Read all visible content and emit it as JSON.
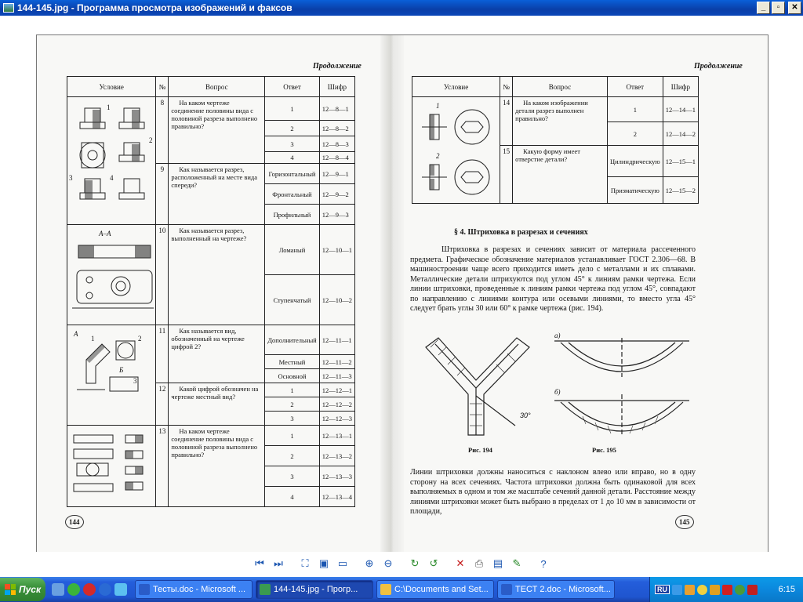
{
  "window": {
    "title": "144-145.jpg - Программа просмотра изображений и факсов",
    "btn_min": "_",
    "btn_max": "▫",
    "btn_close": "✕"
  },
  "left_page": {
    "continuation": "Продолжение",
    "headers": [
      "Условие",
      "№",
      "Вопрос",
      "Ответ",
      "Шифр"
    ],
    "rows": [
      {
        "num": "8",
        "question": "На каком чертеже соединение половины вида с половиной разреза выполнено правильно?",
        "answers": [
          [
            "1",
            "12—8—1"
          ],
          [
            "2",
            "12—8—2"
          ],
          [
            "3",
            "12—8—3"
          ],
          [
            "4",
            "12—8—4"
          ]
        ]
      },
      {
        "num": "9",
        "question": "Как называется разрез, расположенный на месте вида спереди?",
        "answers": [
          [
            "Горизонтальный",
            "12—9—1"
          ],
          [
            "Фронтальный",
            "12—9—2"
          ],
          [
            "Профильный",
            "12—9—3"
          ]
        ]
      },
      {
        "num": "10",
        "question": "Как называется разрез, выполненный на чертеже?",
        "answers": [
          [
            "Ломаный",
            "12—10—1"
          ],
          [
            "Ступенчатый",
            "12—10—2"
          ]
        ]
      },
      {
        "num": "11",
        "question": "Как называется вид, обозначенный на чертеже цифрой 2?",
        "answers": [
          [
            "Дополнительный",
            "12—11—1"
          ],
          [
            "Местный",
            "12—11—2"
          ],
          [
            "Основной",
            "12—11—3"
          ]
        ]
      },
      {
        "num": "12",
        "question": "Какой цифрой обозначен на чертеже местный вид?",
        "answers": [
          [
            "1",
            "12—12—1"
          ],
          [
            "2",
            "12—12—2"
          ],
          [
            "3",
            "12—12—3"
          ]
        ]
      },
      {
        "num": "13",
        "question": "На каком чертеже соединение половины вида с половиной разреза выполнено правильно?",
        "answers": [
          [
            "1",
            "12—13—1"
          ],
          [
            "2",
            "12—13—2"
          ],
          [
            "3",
            "12—13—3"
          ],
          [
            "4",
            "12—13—4"
          ]
        ]
      }
    ],
    "sketch_labels": {
      "aa": "А–А",
      "a": "А",
      "b": "Б",
      "n1": "1",
      "n2": "2",
      "n3": "3",
      "n4": "4"
    },
    "page_number": "144"
  },
  "right_page": {
    "continuation": "Продолжение",
    "headers": [
      "Условие",
      "№",
      "Вопрос",
      "Ответ",
      "Шифр"
    ],
    "rows": [
      {
        "num": "14",
        "question": "На каком изображении детали разрез выполнен правильно?",
        "answers": [
          [
            "1",
            "12—14—1"
          ],
          [
            "2",
            "12—14—2"
          ]
        ]
      },
      {
        "num": "15",
        "question": "Какую форму имеет отверстие детали?",
        "answers": [
          [
            "Цилиндрическую",
            "12—15—1"
          ],
          [
            "Призматическую",
            "12—15—2"
          ]
        ]
      }
    ],
    "sketch_labels": {
      "n1": "1",
      "n2": "2"
    },
    "section_title": "§ 4. Штриховка в разрезах и сечениях",
    "paragraph1": "Штриховка в разрезах и сечениях зависит от материала рассеченного предмета. Графическое обозначение материалов устанавливает ГОСТ 2.306—68. В машиностроении чаще всего приходится иметь дело с металлами и их сплавами. Металлические детали штрихуются под углом 45° к линиям рамки чертежа. Если линии штриховки, проведенные к линиям рамки чертежа под углом 45°, совпадают по направлению с линиями контура или осевыми линиями, то вместо угла 45° следует брать углы 30 или 60° к рамке чертежа (рис. 194).",
    "fig194": "Рис. 194",
    "fig195": "Рис. 195",
    "angle_label": "30°",
    "fig_a": "а)",
    "fig_b": "б)",
    "paragraph2": "Линии штриховки должны наноситься с наклоном влево или вправо, но в одну сторону на всех сечениях. Частота штриховки должна быть одинаковой для всех выполняемых в одном и том же масштабе сечений данной детали. Расстояние между линиями штриховки может быть выбрано в пределах от 1 до 10 мм в зависимости от площади,",
    "page_number": "145"
  },
  "toolbar": {
    "items": [
      "prev-image-icon",
      "next-image-icon",
      "best-fit-icon",
      "actual-size-icon",
      "slideshow-icon",
      "zoom-in-icon",
      "zoom-out-icon",
      "rotate-cw-icon",
      "rotate-ccw-icon",
      "delete-icon",
      "print-icon",
      "save-icon",
      "edit-icon",
      "help-icon"
    ]
  },
  "taskbar": {
    "start_label": "Пуск",
    "tasks": [
      {
        "label": "Тесты.doc - Microsoft ...",
        "icon": "word-icon",
        "active": false
      },
      {
        "label": "144-145.jpg - Прогр...",
        "icon": "image-viewer-icon",
        "active": true
      },
      {
        "label": "C:\\Documents and Set...",
        "icon": "folder-icon",
        "active": false
      },
      {
        "label": "ТЕСТ 2.doc - Microsoft...",
        "icon": "word-icon",
        "active": false
      }
    ],
    "lang": "RU",
    "clock": "6:15"
  },
  "colors": {
    "titlebar": "#0a46b8",
    "taskbar": "#245edb",
    "start": "#3a913a",
    "tray": "#0b88dd"
  }
}
